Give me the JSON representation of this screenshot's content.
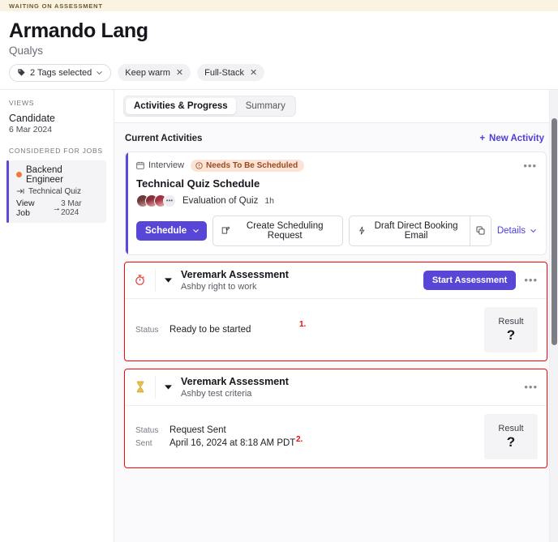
{
  "banner": {
    "status_text": "WAITING ON ASSESSMENT",
    "bg": "#fbf3e1"
  },
  "header": {
    "candidate_name": "Armando Lang",
    "company": "Qualys",
    "tag_select_label": "2 Tags selected",
    "tags": [
      {
        "label": "Keep warm",
        "remove": "✕"
      },
      {
        "label": "Full-Stack",
        "remove": "✕"
      }
    ]
  },
  "sidebar": {
    "views_label": "VIEWS",
    "view_item": {
      "title": "Candidate",
      "date": "6 Mar 2024"
    },
    "jobs_label": "CONSIDERED FOR JOBS",
    "job": {
      "title": "Backend Engineer",
      "stage": "Technical Quiz",
      "view_job_label": "View Job",
      "view_job_arrow": "→",
      "date": "3 Mar 2024",
      "dot_color": "#f07a33",
      "accent_color": "#5a4bd6"
    }
  },
  "main": {
    "tabs": [
      {
        "label": "Activities & Progress",
        "active": true
      },
      {
        "label": "Summary",
        "active": false
      }
    ],
    "section_title": "Current Activities",
    "new_activity_label": "New Activity",
    "new_activity_plus": "+",
    "interview_card": {
      "type_label": "Interview",
      "status_badge": "Needs To Be Scheduled",
      "title": "Technical Quiz Schedule",
      "avatar_overflow": "•••",
      "interview_name": "Evaluation of Quiz",
      "duration": "1h",
      "buttons": {
        "schedule": "Schedule",
        "create_request": "Create Scheduling Request",
        "draft_email": "Draft Direct Booking Email"
      },
      "details_label": "Details",
      "kebab": "•••"
    },
    "assessments": [
      {
        "annotation": "1.",
        "icon": "stopwatch-icon",
        "icon_color": "#e2413f",
        "title": "Veremark Assessment",
        "subtitle": "Ashby right to work",
        "action_label": "Start Assessment",
        "has_action": true,
        "kebab": "•••",
        "fields": [
          {
            "key": "Status",
            "value": "Ready to be started"
          }
        ],
        "result_label": "Result",
        "result_value": "?"
      },
      {
        "annotation": "2.",
        "icon": "hourglass-icon",
        "icon_color": "#d6a829",
        "title": "Veremark Assessment",
        "subtitle": "Ashby test criteria",
        "action_label": "",
        "has_action": false,
        "kebab": "•••",
        "fields": [
          {
            "key": "Status",
            "value": "Request Sent"
          },
          {
            "key": "Sent",
            "value": "April 16, 2024 at 8:18 AM PDT"
          }
        ],
        "result_label": "Result",
        "result_value": "?"
      }
    ]
  },
  "colors": {
    "accent_purple": "#5847d6",
    "link_purple": "#4d3ed4",
    "annotation_red": "#fb0505",
    "warn_badge_bg": "#fbe4d6",
    "warn_badge_fg": "#9a4a22"
  }
}
